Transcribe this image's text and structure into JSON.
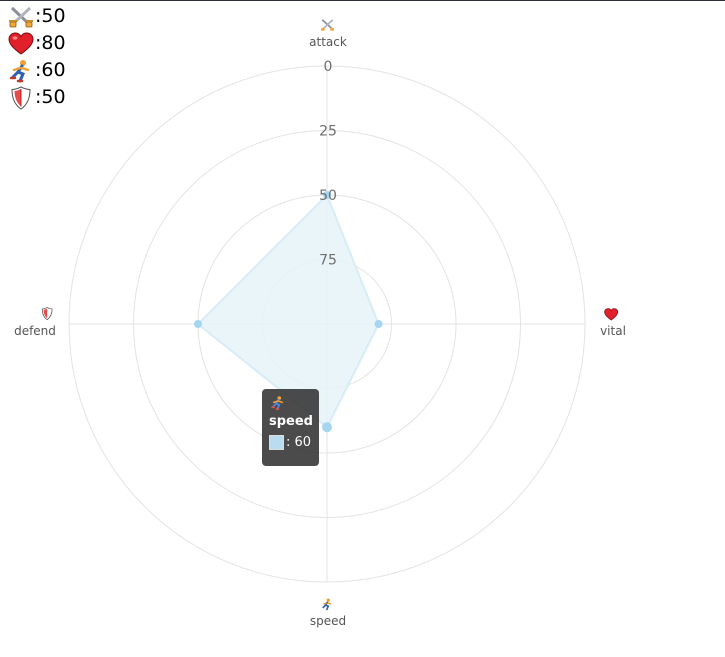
{
  "stats": [
    {
      "icon": "crossed-swords-icon",
      "label": ":50"
    },
    {
      "icon": "heart-icon",
      "label": ":80"
    },
    {
      "icon": "runner-icon",
      "label": ":60"
    },
    {
      "icon": "shield-icon",
      "label": ":50"
    }
  ],
  "chart_data": {
    "type": "radar",
    "indicators": [
      {
        "name": "attack",
        "icon": "crossed-swords-icon"
      },
      {
        "name": "vital",
        "icon": "heart-icon"
      },
      {
        "name": "speed",
        "icon": "runner-icon"
      },
      {
        "name": "defend",
        "icon": "shield-icon"
      }
    ],
    "radial_ticks": [
      "0",
      "25",
      "50",
      "75"
    ],
    "radial_axis": {
      "min": 0,
      "max": 100,
      "inverse": true
    },
    "series": [
      {
        "values": [
          50,
          80,
          60,
          50
        ]
      }
    ],
    "grid": true,
    "colors": {
      "area_fill": "#e6f3f9",
      "area_stroke": "#d7ecf6",
      "point": "#a4d6ef",
      "grid": "#e3e3e3",
      "label": "#555555"
    }
  },
  "tooltip": {
    "icon": "runner-icon",
    "title": "speed",
    "value": ": 60"
  }
}
